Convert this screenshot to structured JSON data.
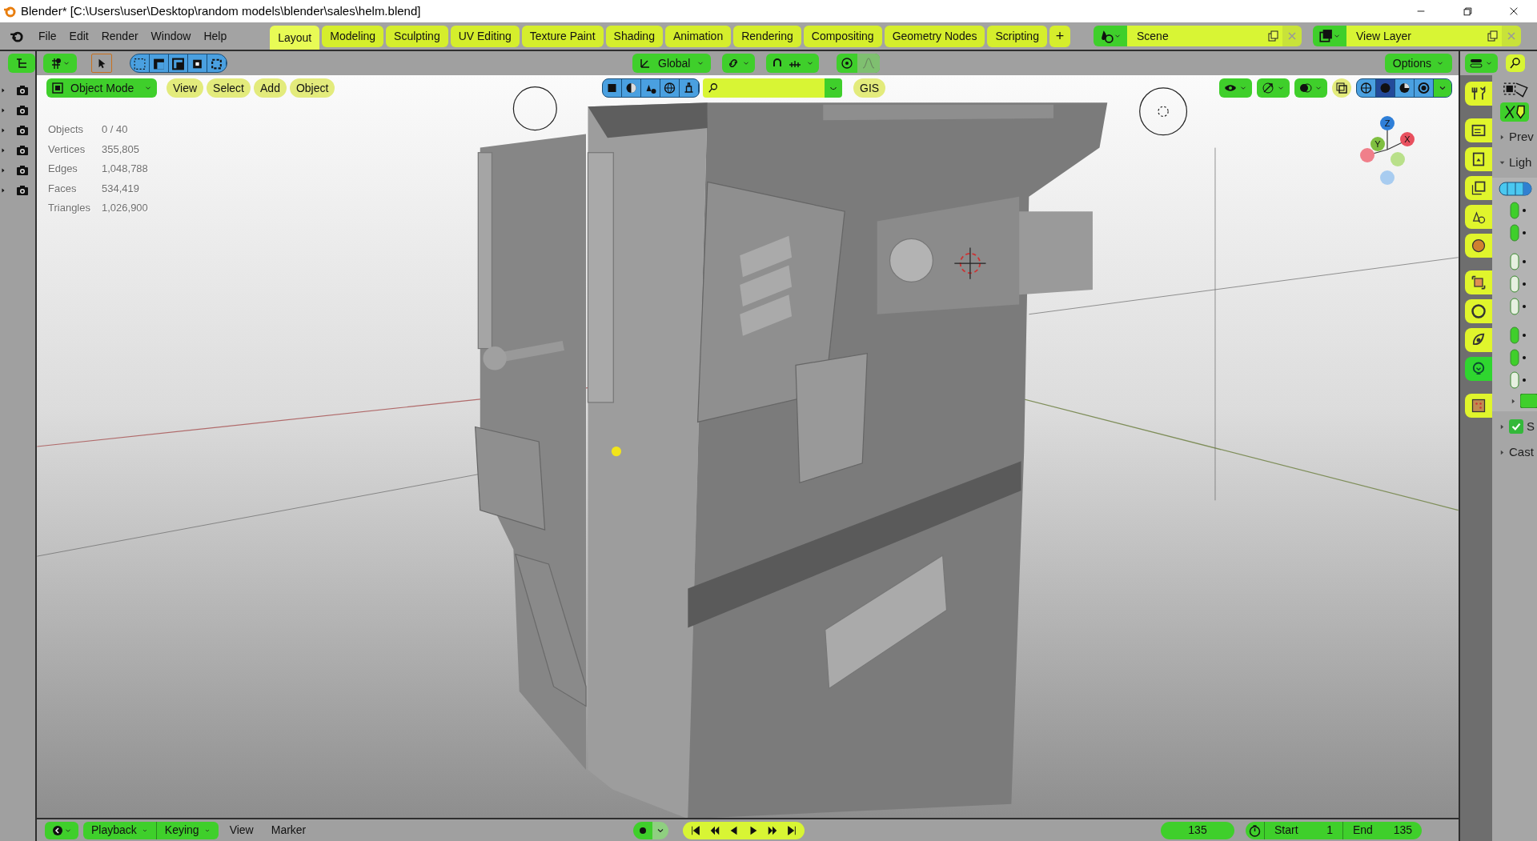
{
  "window": {
    "title": "Blender* [C:\\Users\\user\\Desktop\\random models\\blender\\sales\\helm.blend]"
  },
  "menu": [
    "File",
    "Edit",
    "Render",
    "Window",
    "Help"
  ],
  "workspaces": [
    {
      "label": "Layout",
      "selected": true
    },
    {
      "label": "Modeling",
      "selected": false
    },
    {
      "label": "Sculpting",
      "selected": false
    },
    {
      "label": "UV Editing",
      "selected": false
    },
    {
      "label": "Texture Paint",
      "selected": false
    },
    {
      "label": "Shading",
      "selected": false
    },
    {
      "label": "Animation",
      "selected": false
    },
    {
      "label": "Rendering",
      "selected": false
    },
    {
      "label": "Compositing",
      "selected": false
    },
    {
      "label": "Geometry Nodes",
      "selected": false
    },
    {
      "label": "Scripting",
      "selected": false
    }
  ],
  "add_workspace": "+",
  "scene": "Scene",
  "view_layer": "View Layer",
  "outliner": {
    "rows": [
      {
        "expanded": false
      },
      {
        "expanded": false
      },
      {
        "expanded": false
      },
      {
        "expanded": false
      },
      {
        "expanded": false
      },
      {
        "expanded": false
      }
    ]
  },
  "viewport_header": {
    "orientation": "Global",
    "snapping_on": true,
    "proportional_on": false,
    "options": "Options"
  },
  "viewport": {
    "mode": "Object Mode",
    "menus": [
      "View",
      "Select",
      "Add",
      "Object"
    ],
    "gis": "GIS",
    "stats": [
      {
        "label": "Objects",
        "value": "0 / 40"
      },
      {
        "label": "Vertices",
        "value": "355,805"
      },
      {
        "label": "Edges",
        "value": "1,048,788"
      },
      {
        "label": "Faces",
        "value": "534,419"
      },
      {
        "label": "Triangles",
        "value": "1,026,900"
      }
    ],
    "gizmo_axes": [
      "Z",
      "Y",
      "X"
    ]
  },
  "properties": {
    "tabs": [
      {
        "selected": false
      },
      {
        "selected": false
      },
      {
        "selected": false
      },
      {
        "selected": false
      },
      {
        "selected": false
      },
      {
        "selected": false
      },
      {
        "selected": false
      },
      {
        "selected": false
      },
      {
        "selected": false
      },
      {
        "selected": true
      },
      {
        "selected": false
      }
    ],
    "panels": [
      {
        "kind": "header",
        "label": "Prev",
        "expanded": false
      },
      {
        "kind": "header",
        "label": "Ligh",
        "expanded": true
      },
      {
        "kind": "checkbox",
        "label": "S",
        "checked": true,
        "expanded": false
      },
      {
        "kind": "header",
        "label": "Cast",
        "expanded": false
      }
    ]
  },
  "timeline": {
    "menus": [
      "Playback",
      "Keying"
    ],
    "links": [
      "View",
      "Marker"
    ],
    "current_frame": "135",
    "start_label": "Start",
    "start": "1",
    "end_label": "End",
    "end": "135"
  }
}
